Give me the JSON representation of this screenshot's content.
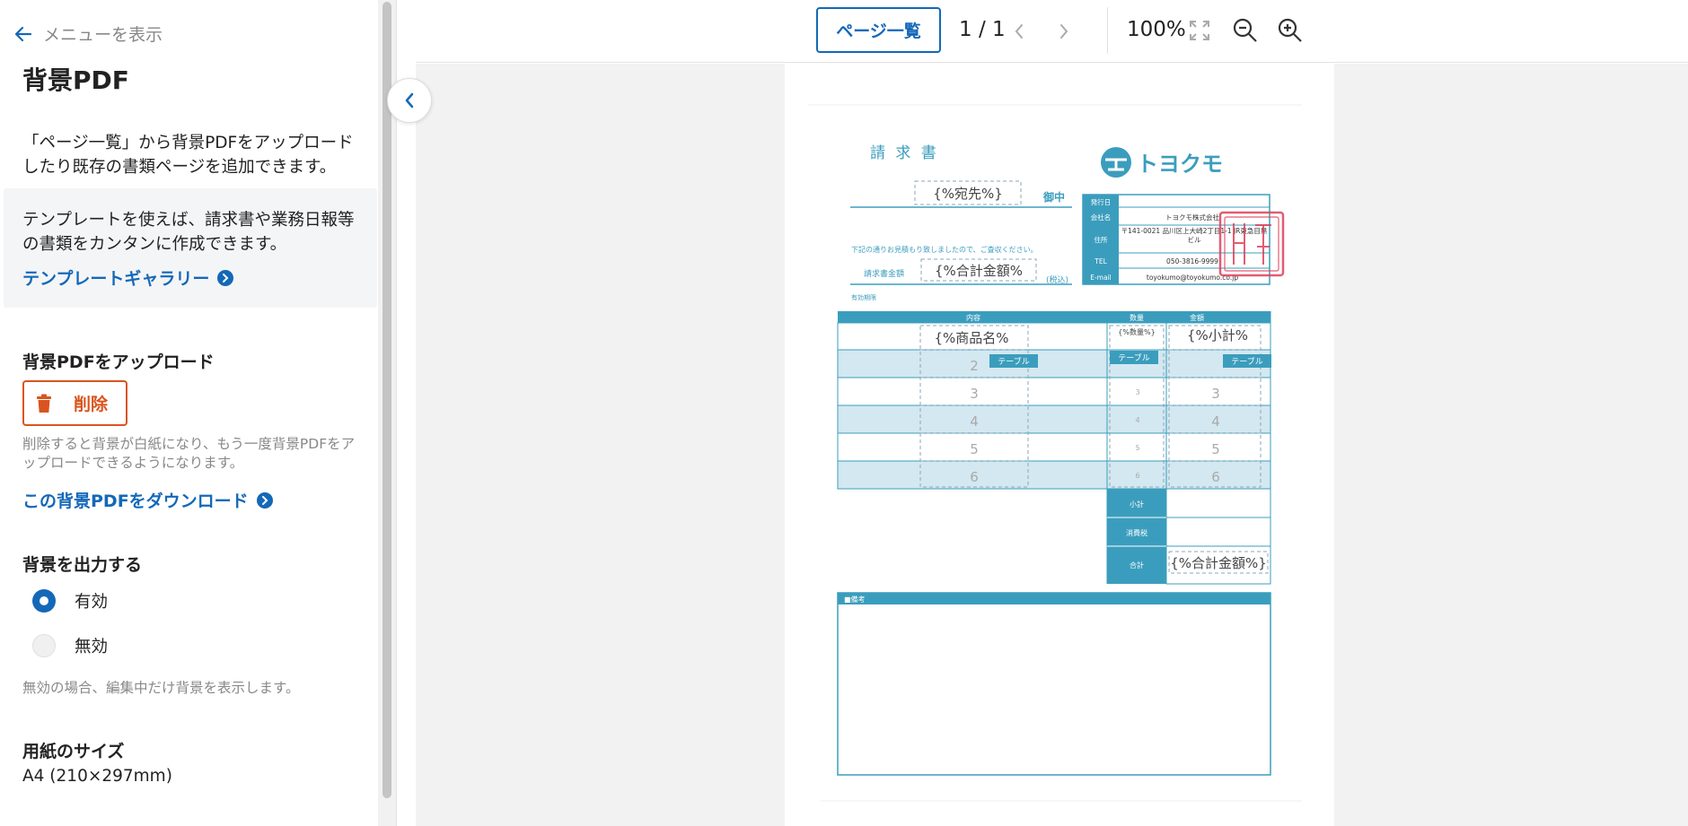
{
  "sidebar": {
    "back_label": "メニューを表示",
    "title": "背景PDF",
    "description": "「ページ一覧」から背景PDFをアップロードしたり既存の書類ページを追加できます。",
    "template_box": {
      "text": "テンプレートを使えば、請求書や業務日報等の書類をカンタンに作成できます。",
      "link_label": "テンプレートギャラリー"
    },
    "upload_section": {
      "heading": "背景PDFをアップロード",
      "delete_label": "削除",
      "note": "削除すると背景が白紙になり、もう一度背景PDFをアップロードできるようになります。",
      "download_label": "この背景PDFをダウンロード"
    },
    "output_section": {
      "heading": "背景を出力する",
      "option_on": "有効",
      "option_off": "無効",
      "selected": "有効",
      "note": "無効の場合、編集中だけ背景を表示します。"
    },
    "paper_section": {
      "heading": "用紙のサイズ",
      "value": "A4 (210×297mm)"
    }
  },
  "toolbar": {
    "pages_button": "ページ一覧",
    "page_indicator": "1 / 1",
    "zoom": "100%"
  },
  "document": {
    "title": "請 求 書",
    "company_logo": "トヨクモ",
    "to_field": "{%宛先%}",
    "honorific": "御中",
    "greeting": "下記の通りお見積もり致しましたので、ご査収ください。",
    "amount_label": "請求書金額",
    "amount_field": "{%合計金額%",
    "tax_incl": "(税込)",
    "due_label": "有効期限",
    "info_rows": [
      {
        "label": "発行日",
        "value": ""
      },
      {
        "label": "会社名",
        "value": "トヨクモ株式会社"
      },
      {
        "label": "住所",
        "value": "〒141-0021 品川区上大崎2丁目1-1 JR東急目黒ビル"
      },
      {
        "label": "TEL",
        "value": "050-3816-9999"
      },
      {
        "label": "E-mail",
        "value": "toyokumo@toyokumo.co.jp"
      }
    ],
    "headers": [
      "内容",
      "数量",
      "金額"
    ],
    "item_field": "{%商品名%",
    "qty_field": "{%数量%}",
    "subtotal_field": "{%小計%",
    "table_tag": "テーブル",
    "row_numbers": [
      "2",
      "3",
      "4",
      "5",
      "6"
    ],
    "summary_labels": [
      "小計",
      "消費税",
      "合計"
    ],
    "total_field": "{%合計金額%}",
    "remarks_label": "■備考",
    "stamp_text": "トヨクモ株式会社"
  },
  "colors": {
    "accent": "#1468b8",
    "danger": "#d9541e",
    "doc_teal": "#3b9dbd",
    "doc_light": "#d3e8f0",
    "stamp": "#e0405a"
  }
}
